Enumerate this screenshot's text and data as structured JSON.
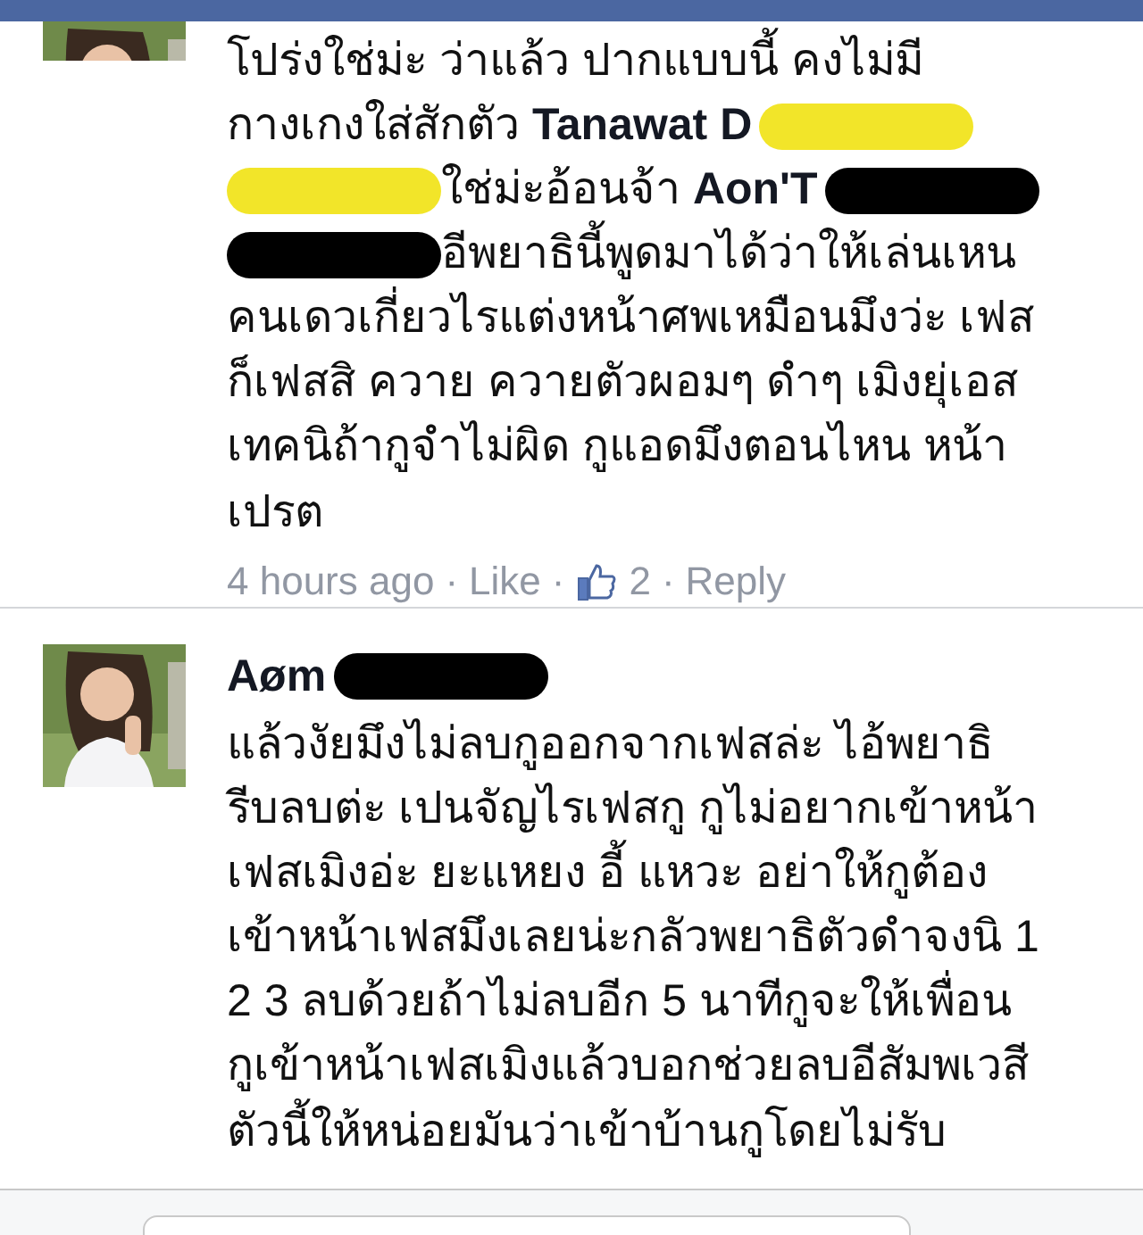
{
  "comments": [
    {
      "avatar": {
        "kind": "picture"
      },
      "lines": [
        [
          {
            "kind": "text",
            "text": "โปร่งใช่ม่ะ ว่าแล้ว ปากแบบนี้ คงไม่มี"
          }
        ],
        [
          {
            "kind": "text",
            "text": "กางเกงใส่สักตัว "
          },
          {
            "kind": "name",
            "text": "Tanawat D"
          },
          {
            "kind": "redaction",
            "color": "#f2e529"
          }
        ],
        [
          {
            "kind": "redaction",
            "color": "#f2e529"
          },
          {
            "kind": "text",
            "text": "ใช่ม่ะอ้อนจ้า "
          },
          {
            "kind": "name",
            "text": "Aon'T"
          },
          {
            "kind": "redaction",
            "color": "#000000"
          }
        ],
        [
          {
            "kind": "redaction",
            "color": "#000000"
          },
          {
            "kind": "text",
            "text": "อีพยาธินี้พูดมาได้ว่าให้เล่นเหน"
          }
        ],
        [
          {
            "kind": "text",
            "text": "คนเดวเกี่ยวไรแต่งหน้าศพเหมือนมึงว่ะ เฟส"
          }
        ],
        [
          {
            "kind": "text",
            "text": "ก็เฟสสิ ควาย ควายตัวผอมๆ ดำๆ เมิงยุ่เอส"
          }
        ],
        [
          {
            "kind": "text",
            "text": "เทคนิถ้ากูจำไม่ผิด กูแอดมึงตอนไหน หน้า"
          }
        ],
        [
          {
            "kind": "text",
            "text": "เปรต"
          }
        ]
      ],
      "meta": {
        "time": "4 hours ago",
        "sep": "·",
        "like": "Like",
        "likes": "2",
        "reply": "Reply"
      }
    },
    {
      "avatar": {
        "kind": "picture"
      },
      "author": [
        {
          "kind": "name",
          "text": "Aøm"
        },
        {
          "kind": "redaction",
          "color": "#000000"
        }
      ],
      "lines": [
        [
          {
            "kind": "text",
            "text": "แล้วงัยมึงไม่ลบกูออกจากเฟสล่ะ ไอ้พยาธิ"
          }
        ],
        [
          {
            "kind": "text",
            "text": "รีบลบต่ะ เปนจัญไรเฟสกู กูไม่อยากเข้าหน้า"
          }
        ],
        [
          {
            "kind": "text",
            "text": "เฟสเมิงอ่ะ ยะแหยง อี้ แหวะ อย่าให้กูต้อง"
          }
        ],
        [
          {
            "kind": "text",
            "text": "เข้าหน้าเฟสมึงเลยน่ะกลัวพยาธิตัวดำจงนิ 1"
          }
        ],
        [
          {
            "kind": "text",
            "text": "2 3 ลบด้วยถ้าไม่ลบอีก 5 นาทีกูจะให้เพื่อน"
          }
        ],
        [
          {
            "kind": "text",
            "text": "กูเข้าหน้าเฟสเมิงแล้วบอกช่วยลบอีสัมพเวสี"
          }
        ],
        [
          {
            "kind": "text",
            "text": "ตัวนี้ให้หน่อยมันว่าเข้าบ้านกูโดยไม่รับ"
          }
        ]
      ]
    }
  ]
}
